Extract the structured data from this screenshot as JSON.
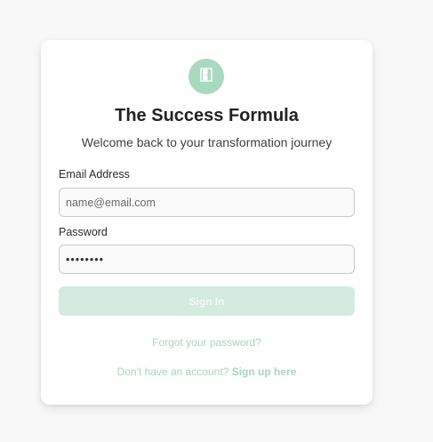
{
  "brand": {
    "title": "The Success Formula",
    "subtitle": "Welcome back to your transformation journey",
    "logo_icon": "door-icon",
    "accent_color": "#a9d9c1"
  },
  "form": {
    "email_label": "Email Address",
    "email_placeholder": "name@email.com",
    "email_value": "",
    "password_label": "Password",
    "password_value": "12345678",
    "signin_label": "Sign In"
  },
  "links": {
    "forgot_password": "Forgot your password?",
    "signup_prompt": "Don't have an account?",
    "signup_link": "Sign up here"
  }
}
